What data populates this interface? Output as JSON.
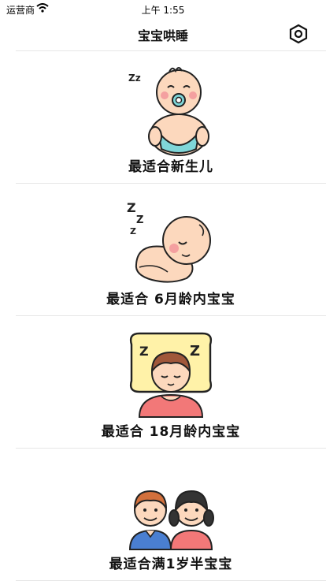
{
  "status_bar": {
    "carrier": "运营商",
    "time": "上午 1:55"
  },
  "nav": {
    "title": "宝宝哄睡",
    "settings_icon": "settings-hexagon-icon"
  },
  "items": [
    {
      "label": "最适合新生儿",
      "icon": "newborn-baby-icon"
    },
    {
      "label": "最适合 6月龄内宝宝",
      "icon": "sleeping-baby-icon"
    },
    {
      "label": "最适合 18月龄内宝宝",
      "icon": "toddler-on-pillow-icon"
    },
    {
      "label": "最适合满1岁半宝宝",
      "icon": "two-children-icon"
    }
  ],
  "colors": {
    "skin": "#fcd8bd",
    "cheek": "#f4a0a0",
    "diaper": "#7fd6d8",
    "pillow": "#fff2a8",
    "shirt_red": "#f27878",
    "shirt_blue": "#4a7fd1",
    "hair_brown": "#a0573a",
    "hair_orange": "#d2703c",
    "hair_dark": "#333333",
    "outline": "#222222"
  }
}
